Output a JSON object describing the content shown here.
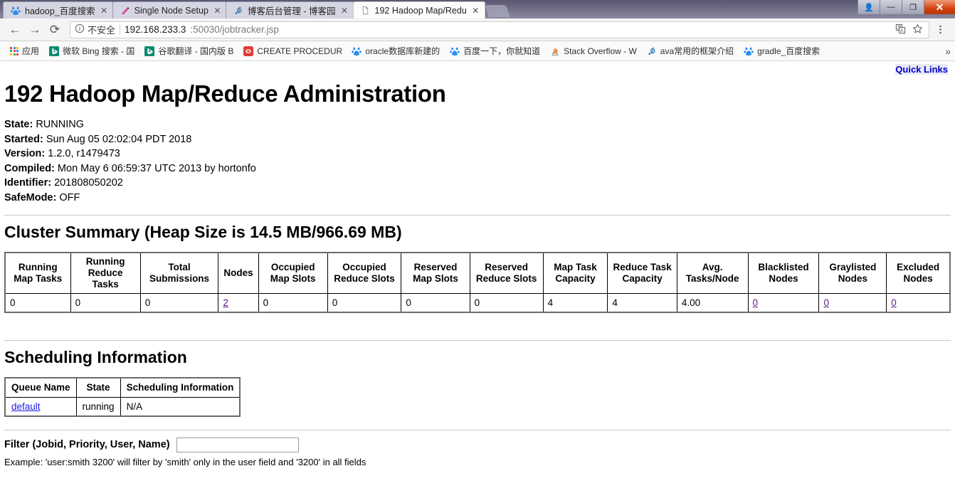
{
  "browser": {
    "tabs": [
      {
        "title": "hadoop_百度搜索",
        "favicon": "baidu-icon",
        "active": false
      },
      {
        "title": "Single Node Setup",
        "favicon": "hadoop-icon",
        "active": false
      },
      {
        "title": "博客后台管理 - 博客园",
        "favicon": "cnblogs-icon",
        "active": false
      },
      {
        "title": "192 Hadoop Map/Redu",
        "favicon": "page-icon",
        "active": true
      }
    ],
    "tab_close_label": "✕",
    "window_controls": [
      {
        "name": "user-account-button",
        "glyph": "👤"
      },
      {
        "name": "minimize-button",
        "glyph": "—"
      },
      {
        "name": "maximize-button",
        "glyph": "❐"
      },
      {
        "name": "close-button",
        "glyph": "✕"
      }
    ],
    "nav": {
      "back_label": "←",
      "forward_label": "→",
      "reload_label": "⟳"
    },
    "omnibox": {
      "security_icon": "info-circle-icon",
      "security_label": "不安全",
      "url_host": "192.168.233.3",
      "url_path": ":50030/jobtracker.jsp",
      "translate_icon": "translate-icon",
      "bookmark_icon": "star-icon",
      "menu_icon": "three-dot-menu-icon"
    },
    "bookmarks": {
      "apps_label": "应用",
      "items": [
        {
          "label": "微软 Bing 搜索 - 国",
          "favicon": "bing-icon"
        },
        {
          "label": "谷歌翻译 - 国内版 B",
          "favicon": "bing-icon"
        },
        {
          "label": "CREATE PROCEDUR",
          "favicon": "red-square-icon"
        },
        {
          "label": "oracle数据库新建的",
          "favicon": "baidu-icon"
        },
        {
          "label": "百度一下，你就知道",
          "favicon": "baidu-icon"
        },
        {
          "label": "Stack Overflow - W",
          "favicon": "stackoverflow-icon"
        },
        {
          "label": "ava常用的框架介绍",
          "favicon": "cnblogs-icon"
        },
        {
          "label": "gradle_百度搜索",
          "favicon": "baidu-icon"
        }
      ],
      "overflow_label": "»"
    }
  },
  "page": {
    "quick_links_label": "Quick Links",
    "title": "192 Hadoop Map/Reduce Administration",
    "meta": [
      {
        "label": "State:",
        "value": "RUNNING"
      },
      {
        "label": "Started:",
        "value": "Sun Aug 05 02:02:04 PDT 2018"
      },
      {
        "label": "Version:",
        "value": "1.2.0, r1479473"
      },
      {
        "label": "Compiled:",
        "value": "Mon May 6 06:59:37 UTC 2013 by hortonfo"
      },
      {
        "label": "Identifier:",
        "value": "201808050202"
      },
      {
        "label": "SafeMode:",
        "value": "OFF"
      }
    ],
    "cluster_summary": {
      "heading": "Cluster Summary (Heap Size is 14.5 MB/966.69 MB)",
      "columns": [
        "Running Map Tasks",
        "Running Reduce Tasks",
        "Total Submissions",
        "Nodes",
        "Occupied Map Slots",
        "Occupied Reduce Slots",
        "Reserved Map Slots",
        "Reserved Reduce Slots",
        "Map Task Capacity",
        "Reduce Task Capacity",
        "Avg. Tasks/Node",
        "Blacklisted Nodes",
        "Graylisted Nodes",
        "Excluded Nodes"
      ],
      "values": [
        {
          "text": "0",
          "link": false
        },
        {
          "text": "0",
          "link": false
        },
        {
          "text": "0",
          "link": false
        },
        {
          "text": "2",
          "link": true
        },
        {
          "text": "0",
          "link": false
        },
        {
          "text": "0",
          "link": false
        },
        {
          "text": "0",
          "link": false
        },
        {
          "text": "0",
          "link": false
        },
        {
          "text": "4",
          "link": false
        },
        {
          "text": "4",
          "link": false
        },
        {
          "text": "4.00",
          "link": false
        },
        {
          "text": "0",
          "link": true
        },
        {
          "text": "0",
          "link": true
        },
        {
          "text": "0",
          "link": true
        }
      ]
    },
    "scheduling": {
      "heading": "Scheduling Information",
      "columns": [
        "Queue Name",
        "State",
        "Scheduling Information"
      ],
      "rows": [
        {
          "queue_name": "default",
          "state": "running",
          "info": "N/A"
        }
      ]
    },
    "filter": {
      "label": "Filter (Jobid, Priority, User, Name)",
      "value": "",
      "placeholder": "",
      "example": "Example: 'user:smith 3200' will filter by 'smith' only in the user field and '3200' in all fields"
    }
  },
  "colors": {
    "link": "#0000cc",
    "visited_link": "#551a8b",
    "tabstrip": "#6e6c84",
    "close_button": "#d4400f"
  }
}
